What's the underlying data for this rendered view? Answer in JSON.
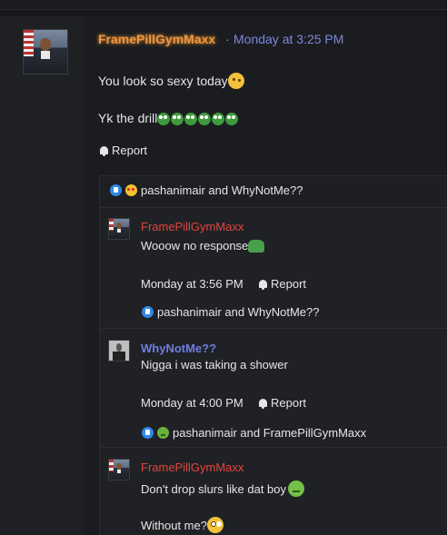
{
  "post": {
    "author": "FramePillGymMaxx",
    "separator": "·",
    "timestamp": "Monday at 3:25 PM",
    "line1": "You look so sexy today",
    "line2": "Yk the drill",
    "report_label": "Report",
    "reactions_text": "pashanimair and WhyNotMe??"
  },
  "comments": [
    {
      "author": "FramePillGymMaxx",
      "text": "Wooow no response",
      "timestamp": "Monday at 3:56 PM",
      "report_label": "Report",
      "reactions_text": "pashanimair and WhyNotMe??"
    },
    {
      "author": "WhyNotMe??",
      "text": "Nigga i was taking a shower",
      "timestamp": "Monday at 4:00 PM",
      "report_label": "Report",
      "reactions_text": "pashanimair and FramePillGymMaxx"
    },
    {
      "author": "FramePillGymMaxx",
      "text": "Don't drop slurs like dat boy",
      "text2": "Without me?"
    }
  ]
}
